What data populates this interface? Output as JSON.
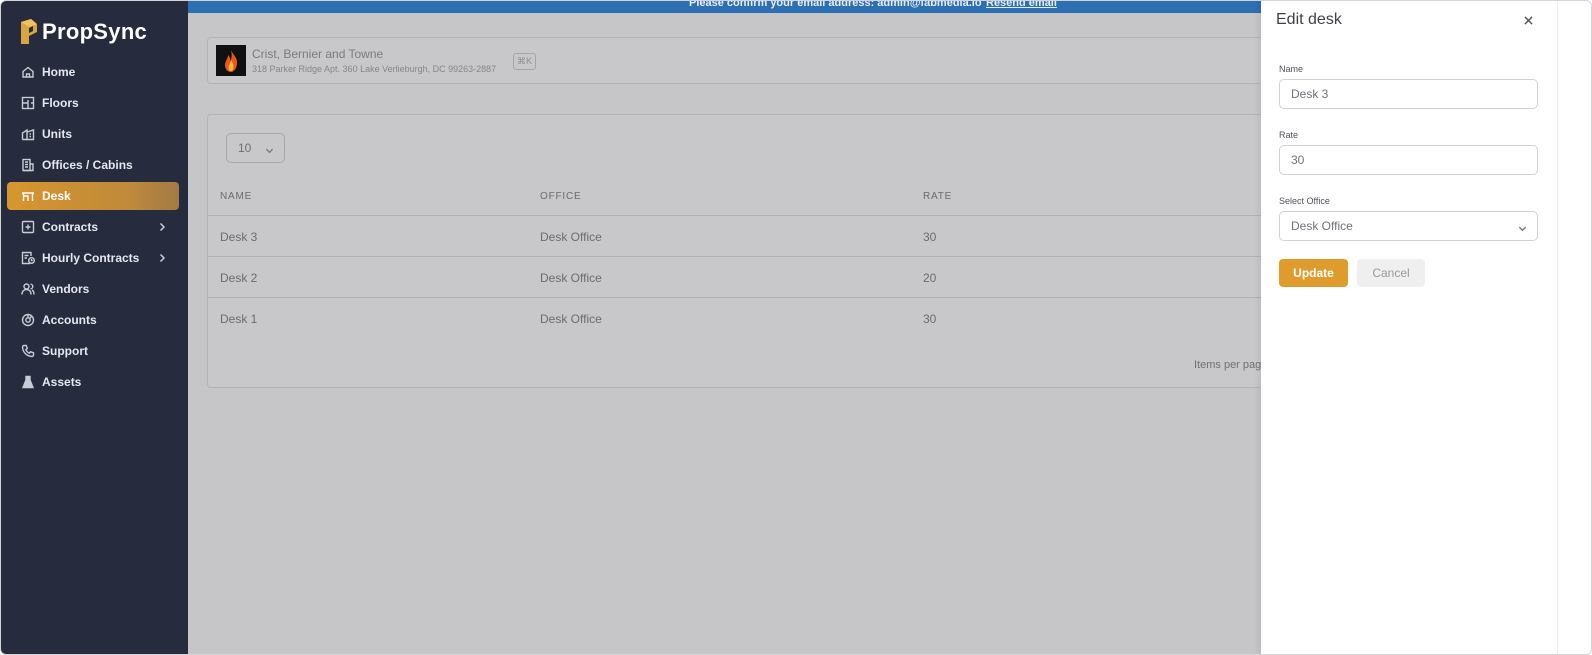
{
  "app": {
    "name": "PropSync",
    "accent": "#e09b2d"
  },
  "sidebar": {
    "items": [
      {
        "label": "Home",
        "icon": "home-icon",
        "active": false,
        "expandable": false
      },
      {
        "label": "Floors",
        "icon": "floors-icon",
        "active": false,
        "expandable": false
      },
      {
        "label": "Units",
        "icon": "units-icon",
        "active": false,
        "expandable": false
      },
      {
        "label": "Offices / Cabins",
        "icon": "offices-icon",
        "active": false,
        "expandable": false
      },
      {
        "label": "Desk",
        "icon": "desk-icon",
        "active": true,
        "expandable": false
      },
      {
        "label": "Contracts",
        "icon": "contracts-icon",
        "active": false,
        "expandable": true
      },
      {
        "label": "Hourly Contracts",
        "icon": "hourly-contracts-icon",
        "active": false,
        "expandable": true
      },
      {
        "label": "Vendors",
        "icon": "vendors-icon",
        "active": false,
        "expandable": false
      },
      {
        "label": "Accounts",
        "icon": "accounts-icon",
        "active": false,
        "expandable": false
      },
      {
        "label": "Support",
        "icon": "support-icon",
        "active": false,
        "expandable": false
      },
      {
        "label": "Assets",
        "icon": "assets-icon",
        "active": false,
        "expandable": false
      }
    ]
  },
  "banner": {
    "message": "Please confirm your email address: admin@fabmedia.io",
    "link": "Resend email"
  },
  "company": {
    "name": "Crist, Bernier and Towne",
    "address": "318 Parker Ridge Apt. 360 Lake Verlieburgh, DC 99263-2887",
    "shortcut": "⌘K"
  },
  "table": {
    "page_size": "10",
    "columns": [
      "NAME",
      "OFFICE",
      "RATE"
    ],
    "rows": [
      [
        "Desk 3",
        "Desk Office",
        "30"
      ],
      [
        "Desk 2",
        "Desk Office",
        "20"
      ],
      [
        "Desk 1",
        "Desk Office",
        "30"
      ]
    ],
    "items_per_page_label": "Items per pag"
  },
  "drawer": {
    "title": "Edit desk",
    "fields": {
      "name": {
        "label": "Name",
        "value": "Desk 3"
      },
      "rate": {
        "label": "Rate",
        "value": "30"
      },
      "office": {
        "label": "Select Office",
        "value": "Desk Office"
      }
    },
    "update_label": "Update",
    "cancel_label": "Cancel"
  }
}
